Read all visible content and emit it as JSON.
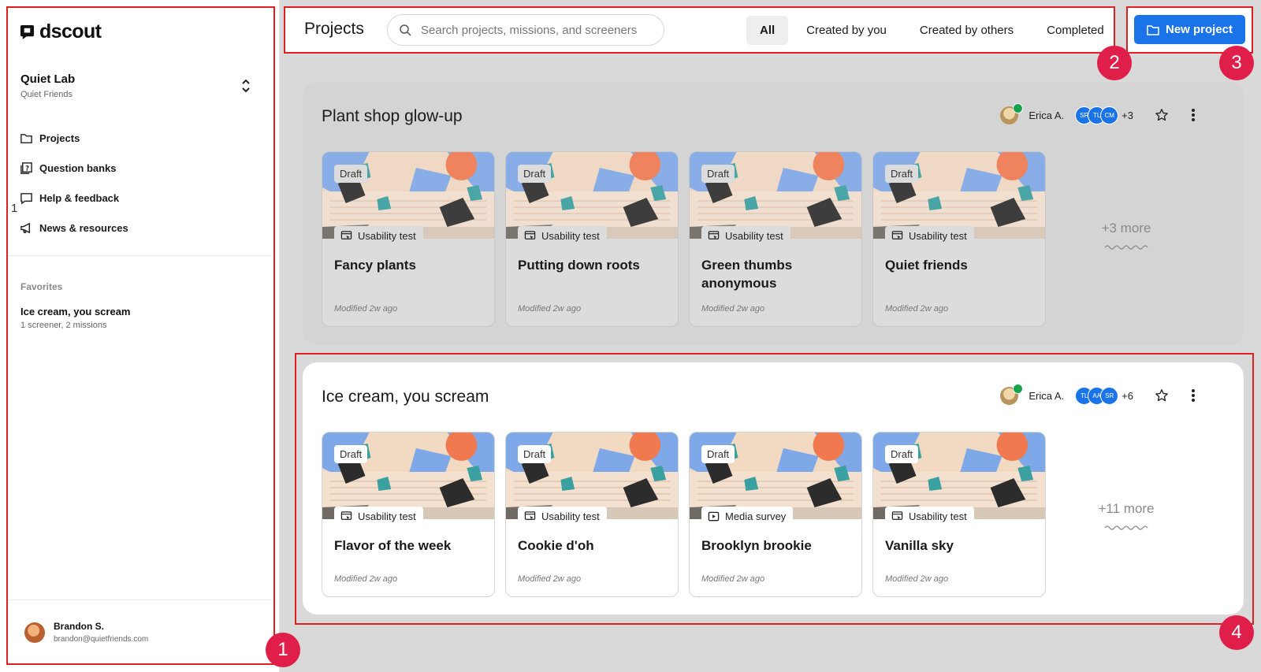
{
  "sidebar": {
    "logo": "dscout",
    "workspace": {
      "name": "Quiet Lab",
      "subtitle": "Quiet Friends"
    },
    "nav": [
      {
        "label": "Projects",
        "icon": "folder-icon"
      },
      {
        "label": "Question banks",
        "icon": "question-bank-icon"
      },
      {
        "label": "Help & feedback",
        "icon": "chat-bubble-icon"
      },
      {
        "label": "News & resources",
        "icon": "megaphone-icon"
      }
    ],
    "favorites_heading": "Favorites",
    "favorites": [
      {
        "title": "Ice cream, you scream",
        "subtitle": "1 screener, 2 missions"
      }
    ],
    "user": {
      "name": "Brandon S.",
      "email": "brandon@quietfriends.com"
    },
    "edge_marker": "1"
  },
  "header": {
    "title": "Projects",
    "search_placeholder": "Search projects, missions, and screeners",
    "filters": [
      {
        "label": "All",
        "active": true
      },
      {
        "label": "Created by you",
        "active": false
      },
      {
        "label": "Created by others",
        "active": false
      },
      {
        "label": "Completed",
        "active": false
      }
    ],
    "new_project": "New project"
  },
  "projects": [
    {
      "title": "Plant shop glow-up",
      "owner": "Erica A.",
      "collaborators": [
        "SR",
        "TL",
        "CM"
      ],
      "more_collaborators": "+3",
      "cards": [
        {
          "status": "Draft",
          "type": "Usability test",
          "type_icon": "usability-test-icon",
          "title": "Fancy plants",
          "modified": "Modified 2w ago"
        },
        {
          "status": "Draft",
          "type": "Usability test",
          "type_icon": "usability-test-icon",
          "title": "Putting down roots",
          "modified": "Modified 2w ago"
        },
        {
          "status": "Draft",
          "type": "Usability test",
          "type_icon": "usability-test-icon",
          "title": "Green thumbs anonymous",
          "modified": "Modified 2w ago"
        },
        {
          "status": "Draft",
          "type": "Usability test",
          "type_icon": "usability-test-icon",
          "title": "Quiet friends",
          "modified": "Modified 2w ago"
        }
      ],
      "more": "+3 more"
    },
    {
      "title": "Ice cream, you scream",
      "owner": "Erica A.",
      "collaborators": [
        "TL",
        "AA",
        "SR"
      ],
      "more_collaborators": "+6",
      "cards": [
        {
          "status": "Draft",
          "type": "Usability test",
          "type_icon": "usability-test-icon",
          "title": "Flavor of the week",
          "modified": "Modified 2w ago"
        },
        {
          "status": "Draft",
          "type": "Usability test",
          "type_icon": "usability-test-icon",
          "title": "Cookie d'oh",
          "modified": "Modified 2w ago"
        },
        {
          "status": "Draft",
          "type": "Media survey",
          "type_icon": "media-survey-icon",
          "title": "Brooklyn brookie",
          "modified": "Modified 2w ago"
        },
        {
          "status": "Draft",
          "type": "Usability test",
          "type_icon": "usability-test-icon",
          "title": "Vanilla sky",
          "modified": "Modified 2w ago"
        }
      ],
      "more": "+11 more"
    }
  ],
  "annotations": [
    "1",
    "2",
    "3",
    "4"
  ],
  "colors": {
    "accent": "#1a73e8",
    "annotation": "#e02020",
    "marker": "#e01e4a",
    "check": "#16a34a"
  }
}
